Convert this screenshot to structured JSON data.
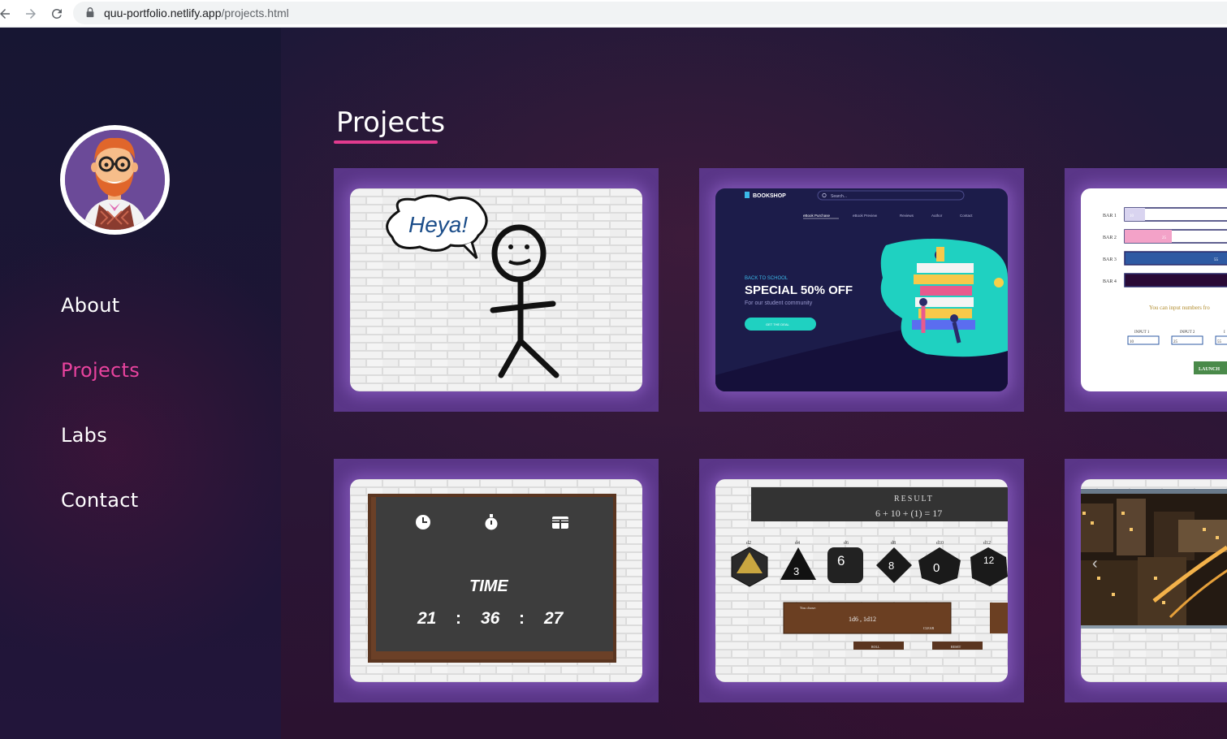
{
  "browser": {
    "url_host": "quu-portfolio.netlify.app",
    "url_path": "/projects.html"
  },
  "sidebar": {
    "nav": [
      {
        "label": "About",
        "active": false
      },
      {
        "label": "Projects",
        "active": true
      },
      {
        "label": "Labs",
        "active": false
      },
      {
        "label": "Contact",
        "active": false
      }
    ]
  },
  "main": {
    "title": "Projects",
    "projects": [
      {
        "name": "heya-stickman",
        "speech": "Heya!"
      },
      {
        "name": "bookshop",
        "brand": "BOOKSHOP",
        "search_placeholder": "Search...",
        "menu": [
          "eBook Purchase",
          "eBook Preview",
          "Reviews",
          "Author",
          "Contact"
        ],
        "kicker": "BACK TO SCHOOL",
        "headline": "SPECIAL 50% OFF",
        "sub": "For our student community",
        "cta": "GET THE DEAL"
      },
      {
        "name": "bar-chart-input",
        "bars": [
          {
            "label": "BAR 1",
            "value": "10"
          },
          {
            "label": "BAR 2",
            "value": "25"
          },
          {
            "label": "BAR 3",
            "value": "55"
          },
          {
            "label": "BAR 4",
            "value": ""
          }
        ],
        "hint": "You can input numbers fro",
        "inputs": [
          {
            "label": "INPUT 1",
            "value": "10"
          },
          {
            "label": "INPUT 2",
            "value": "25"
          },
          {
            "label": "I",
            "value": "55"
          }
        ],
        "button": "LAUNCH"
      },
      {
        "name": "chalkboard-clock",
        "label": "TIME",
        "hours": "21",
        "minutes": "36",
        "seconds": "27"
      },
      {
        "name": "dice-roller",
        "result_label": "RESULT",
        "result_expr": "6 + 10 + (1) = 17",
        "dice": [
          "d2",
          "d4",
          "d6",
          "d8",
          "d10",
          "d12"
        ],
        "dice_faces": [
          "",
          "3",
          "6",
          "8",
          "0",
          "12"
        ],
        "choice_label": "You chose:",
        "choice_value": "1d6 , 1d12",
        "clear": "CLEAR",
        "roll": "ROLL",
        "reset": "RESET"
      },
      {
        "name": "city-slider"
      }
    ]
  }
}
